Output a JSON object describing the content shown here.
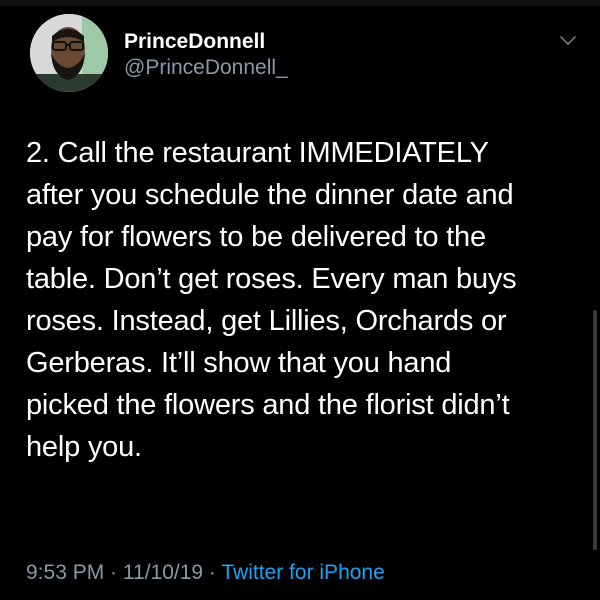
{
  "author": {
    "display_name": "PrinceDonnell",
    "handle": "@PrinceDonnell_"
  },
  "tweet": {
    "lines": [
      "2. Call the restaurant IMMEDIATELY",
      "after you schedule the dinner date and",
      "pay for flowers to be delivered to the",
      "table. Don’t get roses. Every man buys",
      "roses. Instead, get Lillies, Orchards or",
      "Gerberas. It’ll show that you hand",
      "picked the flowers and the florist didn’t",
      "help you."
    ]
  },
  "meta": {
    "time": "9:53 PM",
    "separator_1": " · ",
    "date": "11/10/19",
    "separator_2": " · ",
    "source": "Twitter for iPhone"
  },
  "icons": {
    "menu": "chevron-down-icon",
    "avatar": "avatar"
  },
  "colors": {
    "background": "#000000",
    "text": "#ffffff",
    "secondary": "#8899a6",
    "link": "#1da1f2"
  }
}
